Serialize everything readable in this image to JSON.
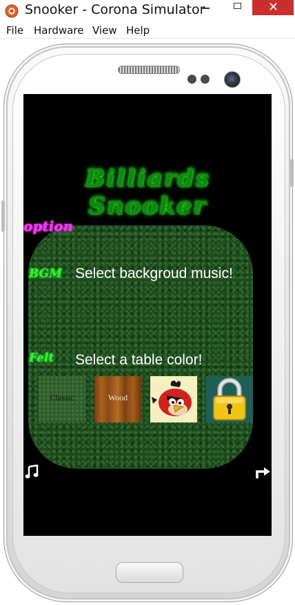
{
  "window": {
    "title": "Snooker - Corona Simulator",
    "close_glyph": "✕",
    "menu": [
      "File",
      "Hardware",
      "View",
      "Help"
    ]
  },
  "game": {
    "title_line1": "Billiards",
    "title_line2": "Snooker",
    "option_label": "option",
    "bgm": {
      "tag": "BGM",
      "description": "Select backgroud music!"
    },
    "felt": {
      "tag": "Felt",
      "description": "Select a table color!"
    },
    "swatches": [
      {
        "label": "Classic",
        "color": "#2f5a2a"
      },
      {
        "label": "Wood",
        "color": "#a8621f"
      },
      {
        "label": "",
        "icon": "angry-bird-icon"
      },
      {
        "label": "",
        "icon": "lock-icon",
        "locked": true
      }
    ],
    "music_icon": "music-note-icon",
    "next_icon": "forward-arrow-icon"
  },
  "colors": {
    "title_green": "#0c8a0c",
    "option_magenta": "#ff33ff",
    "tag_green": "#22ff22",
    "panel_green": "#1d4a1d",
    "close_red": "#c9302c"
  }
}
